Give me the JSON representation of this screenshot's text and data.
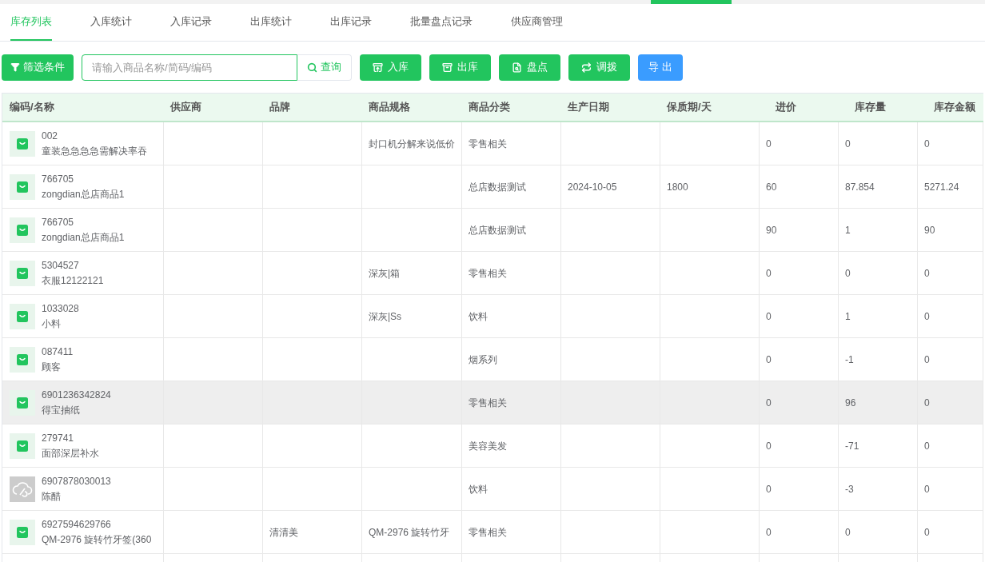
{
  "tabs": [
    {
      "label": "库存列表",
      "selected": true
    },
    {
      "label": "入库统计",
      "selected": false
    },
    {
      "label": "入库记录",
      "selected": false
    },
    {
      "label": "出库统计",
      "selected": false
    },
    {
      "label": "出库记录",
      "selected": false
    },
    {
      "label": "批量盘点记录",
      "selected": false
    },
    {
      "label": "供应商管理",
      "selected": false
    }
  ],
  "toolbar": {
    "filter_button": "筛选条件",
    "search": {
      "placeholder": "请输入商品名称/简码/编码",
      "button": "查询"
    },
    "actions": [
      {
        "label": "入库",
        "kind": "primary"
      },
      {
        "label": "出库",
        "kind": "primary"
      },
      {
        "label": "盘点",
        "kind": "primary"
      },
      {
        "label": "调拨",
        "kind": "primary"
      },
      {
        "label": "导 出",
        "kind": "export"
      }
    ]
  },
  "table": {
    "columns": [
      "编码/名称",
      "供应商",
      "品牌",
      "商品规格",
      "商品分类",
      "生产日期",
      "保质期/天",
      "进价",
      "库存量",
      "库存金额"
    ],
    "rows": [
      {
        "kind": "bag",
        "code": "002",
        "name": "童装急急急急需解决率吞",
        "supplier": "",
        "brand": "",
        "spec": "封口机分解来说低价",
        "category": "零售相关",
        "date": "",
        "shelf_life": "",
        "price": "0",
        "stock": "0",
        "amount": "0",
        "selected": false
      },
      {
        "kind": "bag",
        "code": "766705",
        "name": "zongdian总店商品1",
        "supplier": "",
        "brand": "",
        "spec": "",
        "category": "总店数据测试",
        "date": "2024-10-05",
        "shelf_life": "1800",
        "price": "60",
        "stock": "87.854",
        "amount": "5271.24",
        "selected": false
      },
      {
        "kind": "bag",
        "code": "766705",
        "name": "zongdian总店商品1",
        "supplier": "",
        "brand": "",
        "spec": "",
        "category": "总店数据测试",
        "date": "",
        "shelf_life": "",
        "price": "90",
        "stock": "1",
        "amount": "90",
        "selected": false
      },
      {
        "kind": "bag",
        "code": "5304527",
        "name": "衣服12122121",
        "supplier": "",
        "brand": "",
        "spec": "深灰|箱",
        "category": "零售相关",
        "date": "",
        "shelf_life": "",
        "price": "0",
        "stock": "0",
        "amount": "0",
        "selected": false
      },
      {
        "kind": "bag",
        "code": "1033028",
        "name": "小料",
        "supplier": "",
        "brand": "",
        "spec": "深灰|Ss",
        "category": "饮料",
        "date": "",
        "shelf_life": "",
        "price": "0",
        "stock": "1",
        "amount": "0",
        "selected": false
      },
      {
        "kind": "bag",
        "code": "087411",
        "name": "顾客",
        "supplier": "",
        "brand": "",
        "spec": "",
        "category": "烟系列",
        "date": "",
        "shelf_life": "",
        "price": "0",
        "stock": "-1",
        "amount": "0",
        "selected": false
      },
      {
        "kind": "bag",
        "code": "6901236342824",
        "name": "得宝抽纸",
        "supplier": "",
        "brand": "",
        "spec": "",
        "category": "零售相关",
        "date": "",
        "shelf_life": "",
        "price": "0",
        "stock": "96",
        "amount": "0",
        "selected": true
      },
      {
        "kind": "bag",
        "code": "279741",
        "name": "面部深层补水",
        "supplier": "",
        "brand": "",
        "spec": "",
        "category": "美容美发",
        "date": "",
        "shelf_life": "",
        "price": "0",
        "stock": "-71",
        "amount": "0",
        "selected": false
      },
      {
        "kind": "placeholder",
        "code": "6907878030013",
        "name": "陈醋",
        "supplier": "",
        "brand": "",
        "spec": "",
        "category": "饮料",
        "date": "",
        "shelf_life": "",
        "price": "0",
        "stock": "-3",
        "amount": "0",
        "selected": false
      },
      {
        "kind": "bag",
        "code": "6927594629766",
        "name": "QM-2976 旋转竹牙签(360",
        "supplier": "",
        "brand": "清清美",
        "spec": "QM-2976 旋转竹牙",
        "category": "零售相关",
        "date": "",
        "shelf_life": "",
        "price": "0",
        "stock": "0",
        "amount": "0",
        "selected": false
      }
    ]
  }
}
